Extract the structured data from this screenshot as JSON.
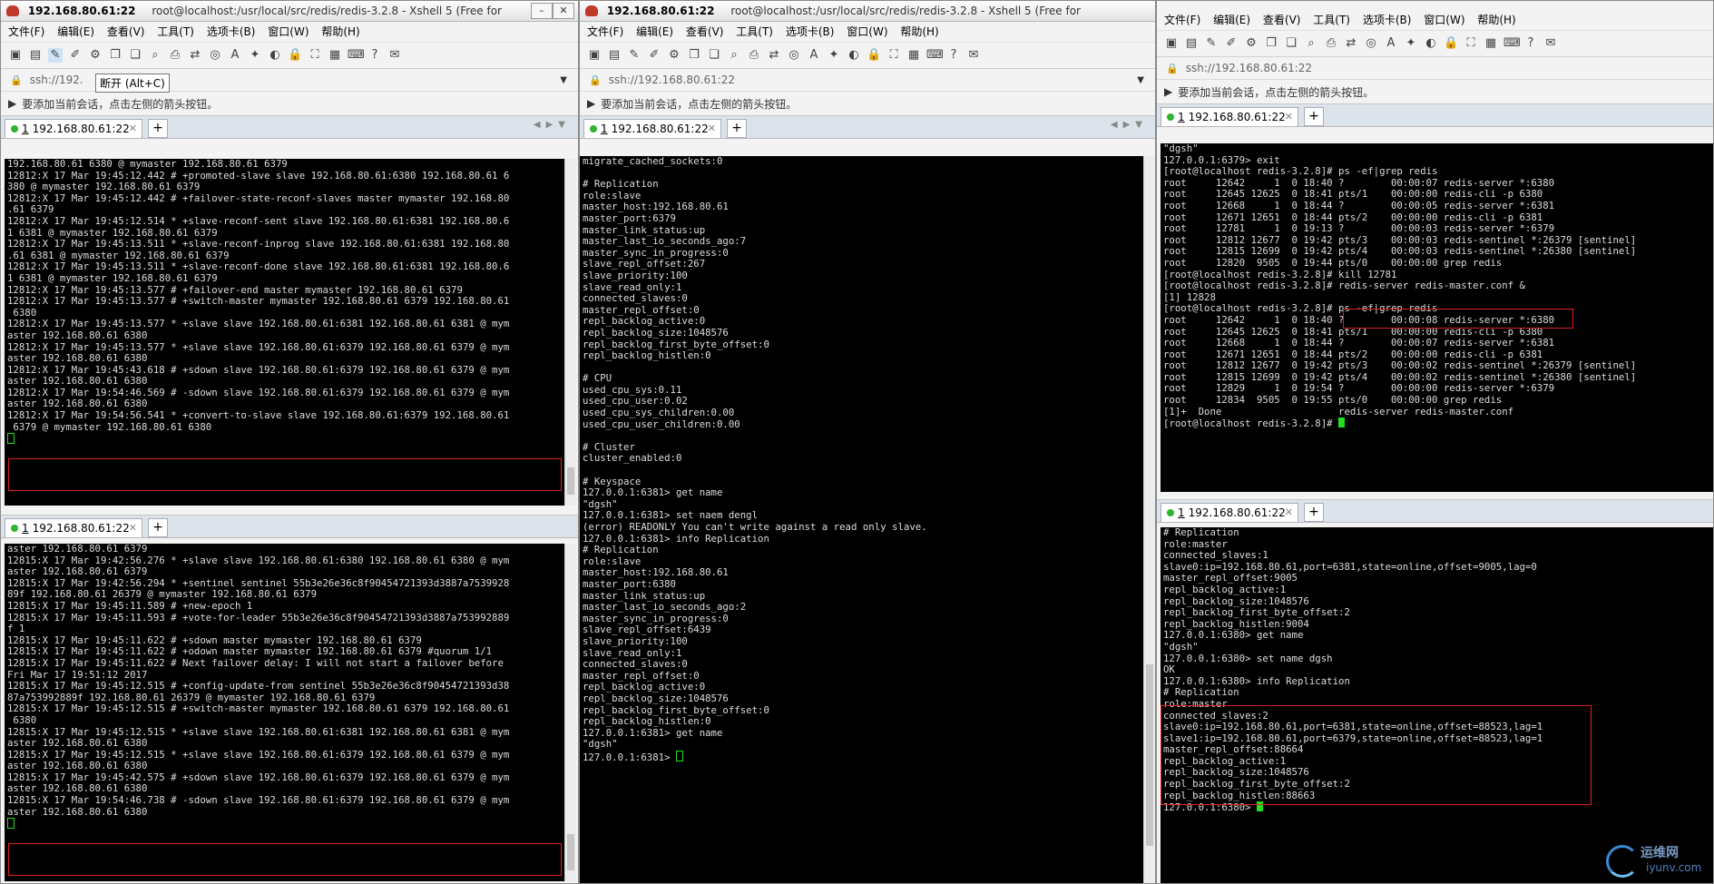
{
  "windows": [
    {
      "title_host": "192.168.80.61:22",
      "title_rest": "root@localhost:/usr/local/src/redis/redis-3.2.8 - Xshell 5 (Free for",
      "menu": [
        "文件(F)",
        "编辑(E)",
        "查看(V)",
        "工具(T)",
        "选项卡(B)",
        "窗口(W)",
        "帮助(H)"
      ],
      "address": "ssh://192.",
      "hint": "要添加当前会话，点击左侧的箭头按钮。",
      "tooltip": "断开 (Alt+C)"
    },
    {
      "title_host": "192.168.80.61:22",
      "title_rest": "root@localhost:/usr/local/src/redis/redis-3.2.8 - Xshell 5 (Free for",
      "menu": [
        "文件(F)",
        "编辑(E)",
        "查看(V)",
        "工具(T)",
        "选项卡(B)",
        "窗口(W)",
        "帮助(H)"
      ],
      "address": "ssh://192.168.80.61:22",
      "hint": "要添加当前会话，点击左侧的箭头按钮。"
    },
    {
      "menu": [
        "文件(F)",
        "编辑(E)",
        "查看(V)",
        "工具(T)",
        "选项卡(B)",
        "窗口(W)",
        "帮助(H)"
      ],
      "address": "ssh://192.168.80.61:22",
      "hint": "要添加当前会话，点击左侧的箭头按钮。"
    }
  ],
  "tab": {
    "number": "1",
    "label": "192.168.80.61:22"
  },
  "terminals": {
    "t1a": [
      "192.168.80.61 6380 @ mymaster 192.168.80.61 6379",
      "12812:X 17 Mar 19:45:12.442 # +promoted-slave slave 192.168.80.61:6380 192.168.80.61 6",
      "380 @ mymaster 192.168.80.61 6379",
      "12812:X 17 Mar 19:45:12.442 # +failover-state-reconf-slaves master mymaster 192.168.80",
      ".61 6379",
      "12812:X 17 Mar 19:45:12.514 * +slave-reconf-sent slave 192.168.80.61:6381 192.168.80.6",
      "1 6381 @ mymaster 192.168.80.61 6379",
      "12812:X 17 Mar 19:45:13.511 * +slave-reconf-inprog slave 192.168.80.61:6381 192.168.80",
      ".61 6381 @ mymaster 192.168.80.61 6379",
      "12812:X 17 Mar 19:45:13.511 * +slave-reconf-done slave 192.168.80.61:6381 192.168.80.6",
      "1 6381 @ mymaster 192.168.80.61 6379",
      "12812:X 17 Mar 19:45:13.577 # +failover-end master mymaster 192.168.80.61 6379",
      "12812:X 17 Mar 19:45:13.577 # +switch-master mymaster 192.168.80.61 6379 192.168.80.61",
      " 6380",
      "12812:X 17 Mar 19:45:13.577 * +slave slave 192.168.80.61:6381 192.168.80.61 6381 @ mym",
      "aster 192.168.80.61 6380",
      "12812:X 17 Mar 19:45:13.577 * +slave slave 192.168.80.61:6379 192.168.80.61 6379 @ mym",
      "aster 192.168.80.61 6380",
      "12812:X 17 Mar 19:45:43.618 # +sdown slave 192.168.80.61:6379 192.168.80.61 6379 @ mym",
      "aster 192.168.80.61 6380",
      "12812:X 17 Mar 19:54:46.569 # -sdown slave 192.168.80.61:6379 192.168.80.61 6379 @ mym",
      "aster 192.168.80.61 6380",
      "12812:X 17 Mar 19:54:56.541 * +convert-to-slave slave 192.168.80.61:6379 192.168.80.61",
      " 6379 @ mymaster 192.168.80.61 6380"
    ],
    "t1b": [
      "aster 192.168.80.61 6379",
      "12815:X 17 Mar 19:42:56.276 * +slave slave 192.168.80.61:6380 192.168.80.61 6380 @ mym",
      "aster 192.168.80.61 6379",
      "12815:X 17 Mar 19:42:56.294 * +sentinel sentinel 55b3e26e36c8f90454721393d3887a7539928",
      "89f 192.168.80.61 26379 @ mymaster 192.168.80.61 6379",
      "12815:X 17 Mar 19:45:11.589 # +new-epoch 1",
      "12815:X 17 Mar 19:45:11.593 # +vote-for-leader 55b3e26e36c8f90454721393d3887a753992889",
      "f 1",
      "12815:X 17 Mar 19:45:11.622 # +sdown master mymaster 192.168.80.61 6379",
      "12815:X 17 Mar 19:45:11.622 # +odown master mymaster 192.168.80.61 6379 #quorum 1/1",
      "12815:X 17 Mar 19:45:11.622 # Next failover delay: I will not start a failover before",
      "Fri Mar 17 19:51:12 2017",
      "12815:X 17 Mar 19:45:12.515 # +config-update-from sentinel 55b3e26e36c8f90454721393d38",
      "87a753992889f 192.168.80.61 26379 @ mymaster 192.168.80.61 6379",
      "12815:X 17 Mar 19:45:12.515 # +switch-master mymaster 192.168.80.61 6379 192.168.80.61",
      " 6380",
      "12815:X 17 Mar 19:45:12.515 * +slave slave 192.168.80.61:6381 192.168.80.61 6381 @ mym",
      "aster 192.168.80.61 6380",
      "12815:X 17 Mar 19:45:12.515 * +slave slave 192.168.80.61:6379 192.168.80.61 6379 @ mym",
      "aster 192.168.80.61 6380",
      "12815:X 17 Mar 19:45:42.575 # +sdown slave 192.168.80.61:6379 192.168.80.61 6379 @ mym",
      "aster 192.168.80.61 6380",
      "12815:X 17 Mar 19:54:46.738 # -sdown slave 192.168.80.61:6379 192.168.80.61 6379 @ mym",
      "aster 192.168.80.61 6380"
    ],
    "t2": [
      "migrate_cached_sockets:0",
      "",
      "# Replication",
      "role:slave",
      "master_host:192.168.80.61",
      "master_port:6379",
      "master_link_status:up",
      "master_last_io_seconds_ago:7",
      "master_sync_in_progress:0",
      "slave_repl_offset:267",
      "slave_priority:100",
      "slave_read_only:1",
      "connected_slaves:0",
      "master_repl_offset:0",
      "repl_backlog_active:0",
      "repl_backlog_size:1048576",
      "repl_backlog_first_byte_offset:0",
      "repl_backlog_histlen:0",
      "",
      "# CPU",
      "used_cpu_sys:0.11",
      "used_cpu_user:0.02",
      "used_cpu_sys_children:0.00",
      "used_cpu_user_children:0.00",
      "",
      "# Cluster",
      "cluster_enabled:0",
      "",
      "# Keyspace",
      "127.0.0.1:6381> get name",
      "\"dgsh\"",
      "127.0.0.1:6381> set naem dengl",
      "(error) READONLY You can't write against a read only slave.",
      "127.0.0.1:6381> info Replication",
      "# Replication",
      "role:slave",
      "master_host:192.168.80.61",
      "master_port:6380",
      "master_link_status:up",
      "master_last_io_seconds_ago:2",
      "master_sync_in_progress:0",
      "slave_repl_offset:6439",
      "slave_priority:100",
      "slave_read_only:1",
      "connected_slaves:0",
      "master_repl_offset:0",
      "repl_backlog_active:0",
      "repl_backlog_size:1048576",
      "repl_backlog_first_byte_offset:0",
      "repl_backlog_histlen:0",
      "127.0.0.1:6381> get name",
      "\"dgsh\"",
      "127.0.0.1:6381> "
    ],
    "t3a": [
      "\"dgsh\"",
      "127.0.0.1:6379> exit",
      "[root@localhost redis-3.2.8]# ps -ef|grep redis",
      "root     12642     1  0 18:40 ?        00:00:07 redis-server *:6380",
      "root     12645 12625  0 18:41 pts/1    00:00:00 redis-cli -p 6380",
      "root     12668     1  0 18:44 ?        00:00:05 redis-server *:6381",
      "root     12671 12651  0 18:44 pts/2    00:00:00 redis-cli -p 6381",
      "root     12781     1  0 19:13 ?        00:00:03 redis-server *:6379",
      "root     12812 12677  0 19:42 pts/3    00:00:03 redis-sentinel *:26379 [sentinel]",
      "root     12815 12699  0 19:42 pts/4    00:00:03 redis-sentinel *:26380 [sentinel]",
      "root     12820  9505  0 19:44 pts/0    00:00:00 grep redis",
      "[root@localhost redis-3.2.8]# kill 12781",
      "[root@localhost redis-3.2.8]# redis-server redis-master.conf &",
      "[1] 12828",
      "[root@localhost redis-3.2.8]# ps -ef|grep redis",
      "root     12642     1  0 18:40 ?        00:00:08 redis-server *:6380",
      "root     12645 12625  0 18:41 pts/1    00:00:00 redis-cli -p 6380",
      "root     12668     1  0 18:44 ?        00:00:07 redis-server *:6381",
      "root     12671 12651  0 18:44 pts/2    00:00:00 redis-cli -p 6381",
      "root     12812 12677  0 19:42 pts/3    00:00:02 redis-sentinel *:26379 [sentinel]",
      "root     12815 12699  0 19:42 pts/4    00:00:02 redis-sentinel *:26380 [sentinel]",
      "root     12829     1  0 19:54 ?        00:00:00 redis-server *:6379",
      "root     12834  9505  0 19:55 pts/0    00:00:00 grep redis",
      "[1]+  Done                    redis-server redis-master.conf",
      "[root@localhost redis-3.2.8]# "
    ],
    "t3b": [
      "# Replication",
      "role:master",
      "connected_slaves:1",
      "slave0:ip=192.168.80.61,port=6381,state=online,offset=9005,lag=0",
      "master_repl_offset:9005",
      "repl_backlog_active:1",
      "repl_backlog_size:1048576",
      "repl_backlog_first_byte_offset:2",
      "repl_backlog_histlen:9004",
      "127.0.0.1:6380> get name",
      "\"dgsh\"",
      "127.0.0.1:6380> set name dgsh",
      "OK",
      "127.0.0.1:6380> info Replication",
      "# Replication",
      "role:master",
      "connected_slaves:2",
      "slave0:ip=192.168.80.61,port=6381,state=online,offset=88523,lag=1",
      "slave1:ip=192.168.80.61,port=6379,state=online,offset=88523,lag=1",
      "master_repl_offset:88664",
      "repl_backlog_active:1",
      "repl_backlog_size:1048576",
      "repl_backlog_first_byte_offset:2",
      "repl_backlog_histlen:88663",
      "127.0.0.1:6380> "
    ]
  },
  "watermark": {
    "top": "运维网",
    "bottom": "iyunv.com"
  },
  "colors": {
    "highlight": "#e02020",
    "cursor": "#20e020",
    "status_dot": "#2db52d"
  }
}
